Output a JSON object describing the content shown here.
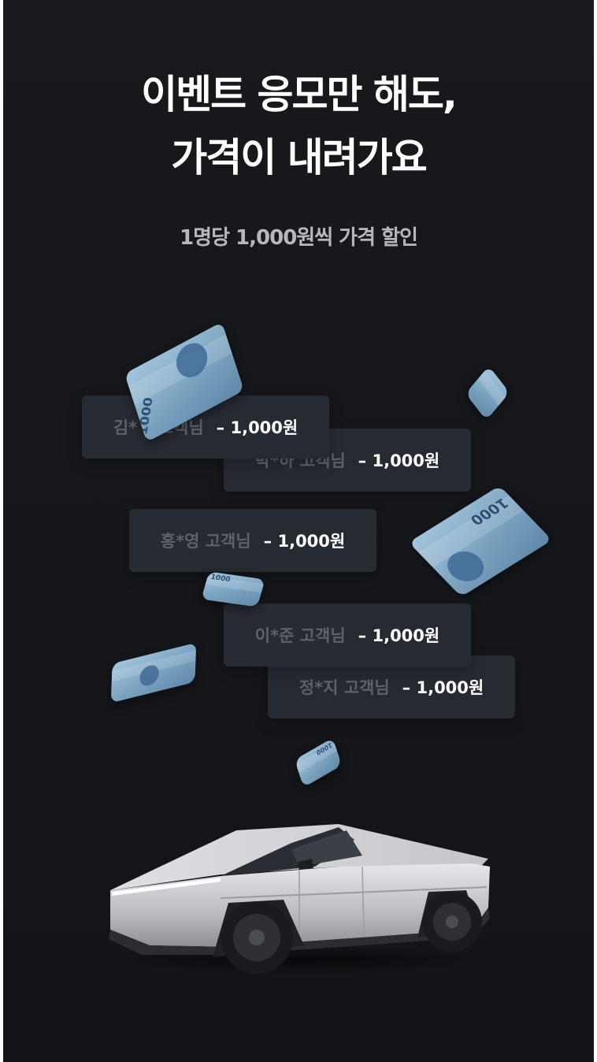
{
  "headline": {
    "line1": "이벤트 응모만 해도,",
    "line2": "가격이 내려가요"
  },
  "subtitle": "1명당 1,000원씩 가격 할인",
  "discount_cards": [
    {
      "name": "김*ㅣ 고객님",
      "amount": "– 1,000원"
    },
    {
      "name": "박*하 고객님",
      "amount": "– 1,000원"
    },
    {
      "name": "홍*영 고객님",
      "amount": "– 1,000원"
    },
    {
      "name": "이*준 고객님",
      "amount": "– 1,000원"
    },
    {
      "name": "정*지 고객님",
      "amount": "– 1,000원"
    }
  ],
  "bill_denomination": "1000",
  "colors": {
    "background": "#15171b",
    "card": "#262a31",
    "banknote": "#8fb3cf"
  },
  "illustration": "cybertruck"
}
